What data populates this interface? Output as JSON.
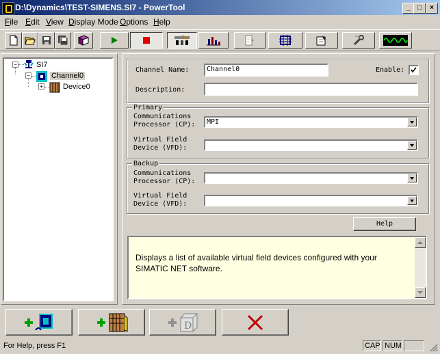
{
  "window": {
    "title": "D:\\Dynamics\\TEST-SIMENS.SI7 - PowerTool",
    "minimize": "_",
    "maximize": "□",
    "close": "×"
  },
  "menu": [
    {
      "label": "File",
      "key": "F"
    },
    {
      "label": "Edit",
      "key": "E"
    },
    {
      "label": "View",
      "key": "V"
    },
    {
      "label": "Display Mode",
      "key": "D"
    },
    {
      "label": "Options",
      "key": "O"
    },
    {
      "label": "Help",
      "key": "H"
    }
  ],
  "toolbar": {
    "buttons": [
      "new-icon",
      "open-icon",
      "save-icon",
      "save-all-icon",
      "book-icon",
      "play-icon",
      "stop-icon",
      "network-config-icon",
      "statistics-icon",
      "properties-icon",
      "hardware-icon",
      "settings-icon",
      "wrench-icon",
      "signal-wave-icon"
    ],
    "colors": {
      "play": "#008000",
      "stop": "#e00000",
      "wave": "#00ff00"
    }
  },
  "tree": {
    "root": {
      "label": "SI7",
      "expander": "−"
    },
    "channel": {
      "label": "Channel0",
      "expander": "−"
    },
    "device": {
      "label": "Device0",
      "expander": "+"
    }
  },
  "form": {
    "channel_name_label": "Channel Name:",
    "channel_name_value": "Channel0",
    "enable_label": "Enable:",
    "enable_checked": true,
    "description_label": "Description:",
    "description_value": "",
    "primary": {
      "title": "Primary",
      "cp_label_1": "Communications",
      "cp_label_2": "Processor (CP):",
      "cp_value": "MPI",
      "vfd_label_1": "Virtual Field",
      "vfd_label_2": "Device (VFD):",
      "vfd_value": ""
    },
    "backup": {
      "title": "Backup",
      "cp_label_1": "Communications",
      "cp_label_2": "Processor (CP):",
      "cp_value": "",
      "vfd_label_1": "Virtual Field",
      "vfd_label_2": "Device (VFD):",
      "vfd_value": ""
    },
    "help_button": "Help"
  },
  "help_text": "Displays a list of available virtual field devices configured with your SIMATIC NET software.",
  "bottom_buttons": [
    "add-channel-icon",
    "add-device-icon",
    "add-datablock-icon",
    "delete-icon"
  ],
  "status": {
    "message": "For Help, press F1",
    "cap": "CAP",
    "num": "NUM",
    "scrl": ""
  }
}
